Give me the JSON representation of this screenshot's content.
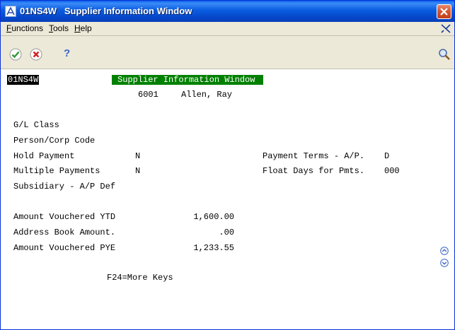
{
  "window": {
    "title_code": "01NS4W",
    "title_name": "Supplier Information Window"
  },
  "menu": {
    "functions_first": "F",
    "functions_rest": "unctions",
    "tools_first": "T",
    "tools_rest": "ools",
    "help_first": "H",
    "help_rest": "elp"
  },
  "toolbar": {
    "ok_icon": "checkmark-icon",
    "cancel_icon": "cancel-icon",
    "help_glyph": "?",
    "search_icon": "magnifier-icon"
  },
  "form": {
    "program_id": "01NS4W",
    "title": "Supplier Information Window",
    "supplier_number": "6001",
    "supplier_name": "Allen, Ray",
    "fields": {
      "gl_class": {
        "label": "G/L Class",
        "value": ""
      },
      "person_corp": {
        "label": "Person/Corp Code",
        "value": ""
      },
      "hold_payment": {
        "label": "Hold Payment",
        "value": "N"
      },
      "multiple_payments": {
        "label": "Multiple Payments",
        "value": "N"
      },
      "subsidiary": {
        "label": "Subsidiary - A/P Def",
        "value": ""
      },
      "payment_terms": {
        "label": "Payment Terms - A/P.",
        "value": "D"
      },
      "float_days": {
        "label": "Float Days for Pmts.",
        "value": "000"
      },
      "amount_vouchered_ytd": {
        "label": "Amount Vouchered YTD",
        "value": "1,600.00"
      },
      "address_book_amount": {
        "label": "Address Book Amount.",
        "value": ".00"
      },
      "amount_vouchered_pye": {
        "label": "Amount Vouchered PYE",
        "value": "1,233.55"
      }
    },
    "footer": "F24=More Keys"
  },
  "colors": {
    "title_bar": "#0a5ce0",
    "form_title_bg": "#008000",
    "program_id_bg": "#000000"
  }
}
